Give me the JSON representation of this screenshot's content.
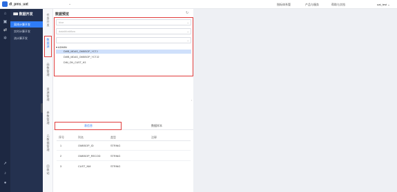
{
  "header": {
    "app_name": "dl_pms_uat",
    "links": [
      "指标体系管",
      "产品与服务",
      "帮助与文档"
    ],
    "user": "uat_test"
  },
  "rail_icons": [
    "home-icon",
    "cube-icon",
    "flow-icon",
    "settings-icon",
    "rocket-icon",
    "bell-icon",
    "user-icon"
  ],
  "nav": {
    "title": "数据开发",
    "items": [
      "离线计算开发",
      "实时计算开发",
      "流计算开发"
    ],
    "active_index": 0
  },
  "vertical_tabs": [
    "任务开发",
    "数据源",
    "函数管理",
    "资源管理",
    "参数管理",
    "元数据管理",
    "回收站"
  ],
  "panel": {
    "title": "数据预览",
    "selects": [
      {
        "placeholder": "hive"
      },
      {
        "placeholder": "dataWorkflow"
      },
      {
        "placeholder": ""
      }
    ],
    "tree_root": "ADMIN",
    "tree_items": [
      {
        "label": "DWB_MDAS_OMBSOP_YCTJ",
        "selected": true
      },
      {
        "label": "DWB_MDAS_OMBSOP_YCTJ2",
        "selected": false
      },
      {
        "label": "DIM_ON_CUST_H3",
        "selected": false
      }
    ],
    "tabs": [
      "表信息",
      "数据样本"
    ],
    "table": {
      "columns": [
        "序号",
        "列名",
        "类型",
        "注释"
      ],
      "rows": [
        [
          "1",
          "OMBSOP_ID",
          "STRING",
          ""
        ],
        [
          "2",
          "OMBSOP_RECOD",
          "STRING",
          ""
        ],
        [
          "3",
          "CUST_NM",
          "STRING",
          ""
        ]
      ]
    }
  },
  "colors": {
    "accent": "#2f7cf6",
    "highlight": "#e03a3a",
    "nav_bg": "#24314f"
  }
}
